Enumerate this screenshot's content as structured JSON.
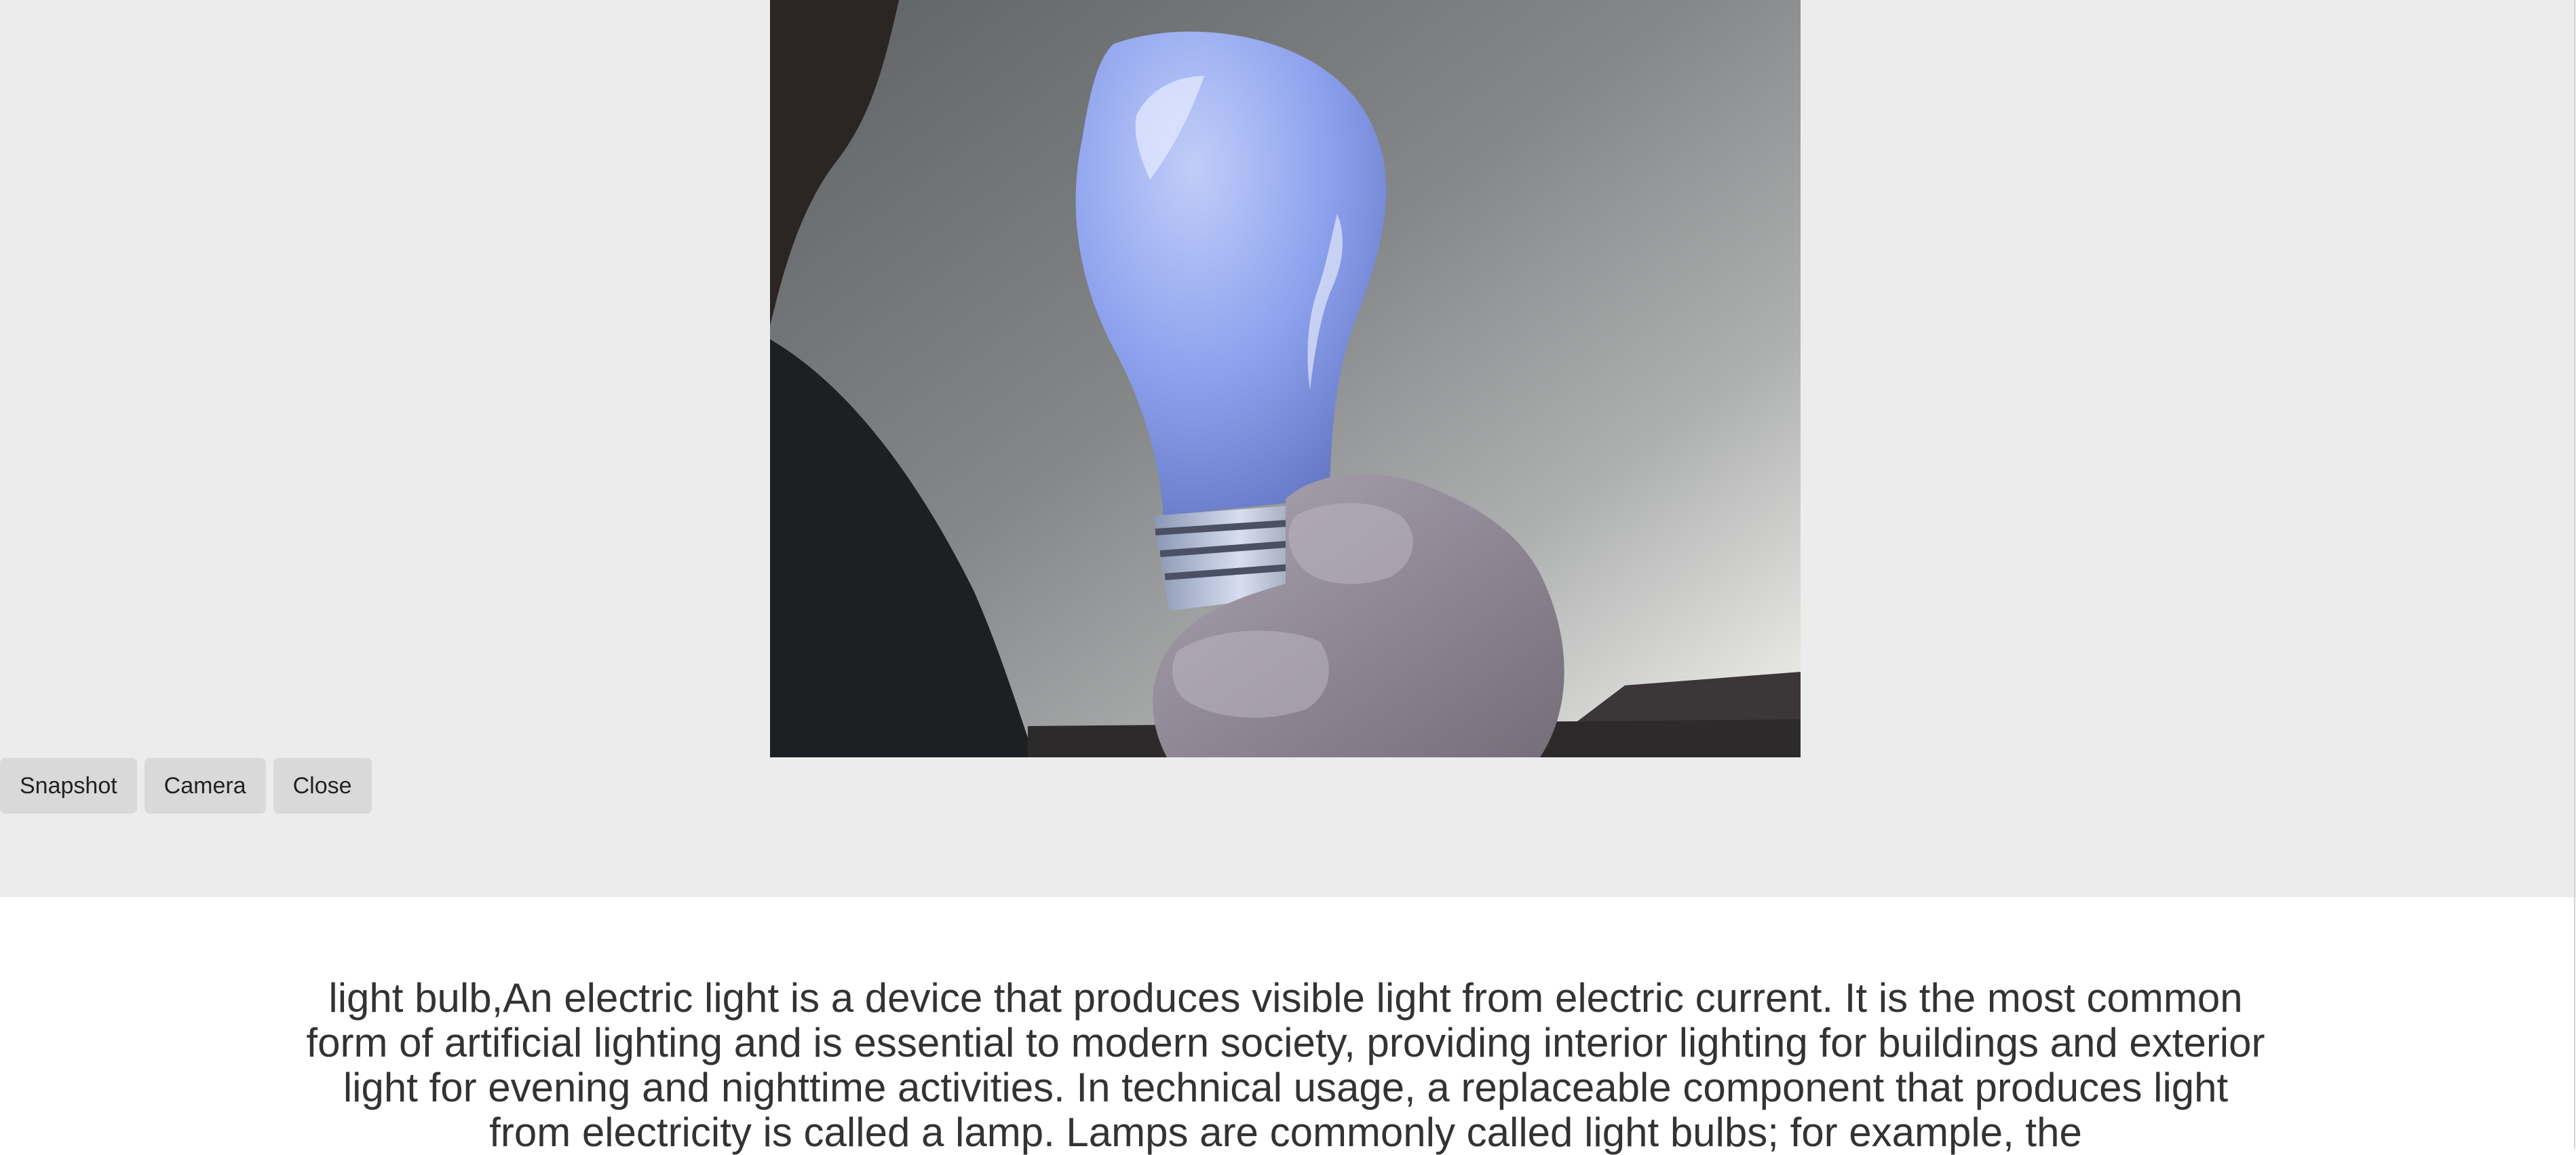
{
  "camera": {
    "subject": "light bulb"
  },
  "toolbar": {
    "snapshot_label": "Snapshot",
    "camera_label": "Camera",
    "close_label": "Close"
  },
  "result": {
    "text": "light bulb,An electric light is a device that produces visible light from electric current. It is the most common form of artificial lighting and is essential to modern society, providing interior lighting for buildings and exterior light for evening and nighttime activities. In technical usage, a replaceable component that produces light from electricity is called a lamp. Lamps are commonly called light bulbs; for example, the"
  },
  "colors": {
    "panel_background": "#ececec",
    "page_background": "#ffffff",
    "button_background": "#d9d9d9",
    "text": "#333333"
  }
}
